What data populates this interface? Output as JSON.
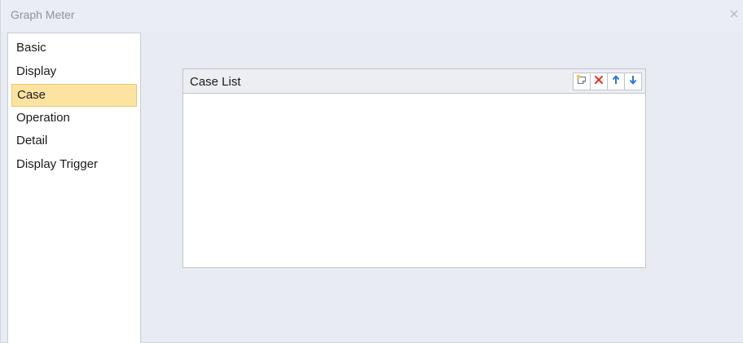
{
  "window": {
    "title": "Graph Meter",
    "close_symbol": "×"
  },
  "sidebar": {
    "items": [
      {
        "label": "Basic",
        "selected": false
      },
      {
        "label": "Display",
        "selected": false
      },
      {
        "label": "Case",
        "selected": true
      },
      {
        "label": "Operation",
        "selected": false
      },
      {
        "label": "Detail",
        "selected": false
      },
      {
        "label": "Display Trigger",
        "selected": false
      }
    ]
  },
  "case_list": {
    "title": "Case List",
    "toolbar": [
      {
        "name": "add-case-button",
        "icon": "new-document-icon"
      },
      {
        "name": "delete-case-button",
        "icon": "red-x-icon"
      },
      {
        "name": "move-up-button",
        "icon": "arrow-up-icon"
      },
      {
        "name": "move-down-button",
        "icon": "arrow-down-icon"
      }
    ],
    "rows": []
  },
  "colors": {
    "selected_bg": "#fde3a2",
    "delete_red": "#e23b2e",
    "arrow_blue": "#2f78d3"
  }
}
